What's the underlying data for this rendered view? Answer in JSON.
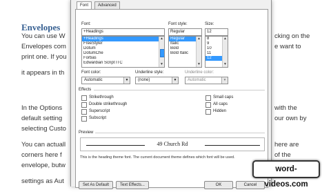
{
  "document": {
    "heading": "Envelopes",
    "lines": [
      {
        "left": "You can use W",
        "right": "cking on the"
      },
      {
        "left": "Envelopes com",
        "right": "e want to"
      },
      {
        "left": "print one. If you",
        "right": ""
      },
      {
        "left": "it appears in th",
        "right": ""
      },
      {
        "left": "In the Options",
        "right": "with the"
      },
      {
        "left": "default setting",
        "right": "our own by"
      },
      {
        "left": "selecting Custo",
        "right": ""
      },
      {
        "left": "You can actuall",
        "right": "here are"
      },
      {
        "left": "corners here f",
        "right": "of the"
      },
      {
        "left": "envelope, butw",
        "right": "ke"
      },
      {
        "left": "settings as Aut",
        "right": ""
      }
    ]
  },
  "dialog": {
    "tabs": [
      "Font",
      "Advanced"
    ],
    "font": {
      "label": "Font:",
      "value": "+Headings",
      "items": [
        "+Headings",
        "FreeStyler",
        "Dotum",
        "DotumChe",
        "Forbas",
        "Edwardian Script ITC"
      ]
    },
    "font_style": {
      "label": "Font style:",
      "value": "Regular",
      "items": [
        "Regular",
        "Italic",
        "Bold",
        "Bold Italic"
      ]
    },
    "size": {
      "label": "Size:",
      "value": "12",
      "items": [
        "8",
        "9",
        "10",
        "11",
        "12"
      ]
    },
    "font_color": {
      "label": "Font color:",
      "value": "Automatic"
    },
    "underline_style": {
      "label": "Underline style:",
      "value": "(none)"
    },
    "underline_color": {
      "label": "Underline color:",
      "value": "Automatic"
    },
    "effects": {
      "label": "Effects",
      "left": [
        {
          "label": "Strikethrough",
          "checked": false
        },
        {
          "label": "Double strikethrough",
          "checked": false
        },
        {
          "label": "Superscript",
          "checked": false
        },
        {
          "label": "Subscript",
          "checked": false
        }
      ],
      "right": [
        {
          "label": "Small caps",
          "checked": false
        },
        {
          "label": "All caps",
          "checked": false
        },
        {
          "label": "Hidden",
          "checked": false
        }
      ]
    },
    "preview": {
      "label": "Preview",
      "text": "49 Church Rd",
      "note": "This is the heading theme font. The current document theme defines which font will be used."
    },
    "buttons": {
      "set_default": "Set As Default",
      "text_effects": "Text Effects...",
      "ok": "OK",
      "cancel": "Cancel"
    }
  },
  "watermark": "word-videos.com"
}
